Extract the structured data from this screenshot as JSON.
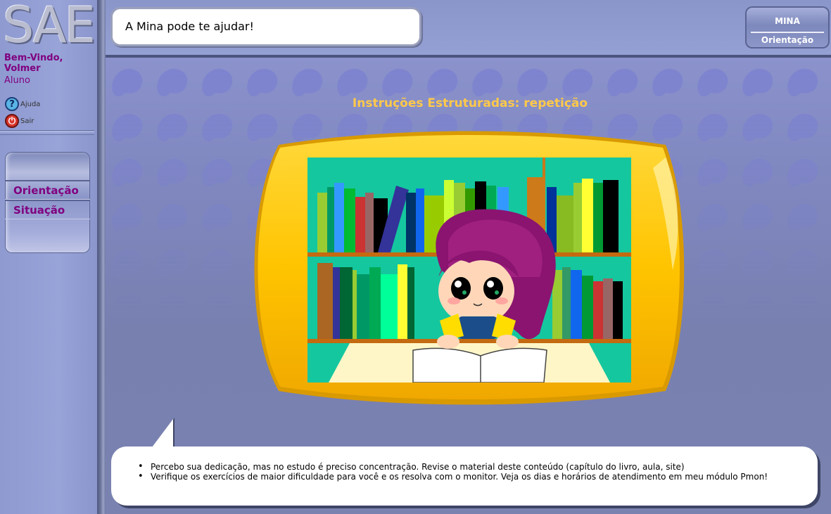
{
  "app": {
    "logo": "SAE"
  },
  "user": {
    "welcome_line1": "Bem-Vindo,",
    "welcome_line2": "Volmer",
    "role": "Aluno"
  },
  "sidebar": {
    "links": [
      {
        "label": "Ajuda",
        "icon": "help-icon"
      },
      {
        "label": "Sair",
        "icon": "power-icon"
      }
    ],
    "menu": [
      {
        "label": "Orientação"
      },
      {
        "label": "Situação"
      }
    ]
  },
  "header": {
    "message": "A Mina pode te ajudar!",
    "mina_button": {
      "title": "MINA",
      "subtitle": "Orientação"
    }
  },
  "main": {
    "title": "Instruções Estruturadas: repetição",
    "tips": [
      "Percebo sua dedicação, mas no estudo é preciso concentração. Revise o material deste conteúdo (capítulo do livro, aula, site)",
      "Verifique os exercícios de maior dificuldade para você e os resolva com o monitor. Veja os dias e horários de atendimento em meu módulo Pmon!"
    ]
  },
  "colors": {
    "brand_purple": "#800080",
    "title_gold": "#ffc94a",
    "tv_yellow": "#ffc400",
    "picture_bg": "#15c79f"
  }
}
